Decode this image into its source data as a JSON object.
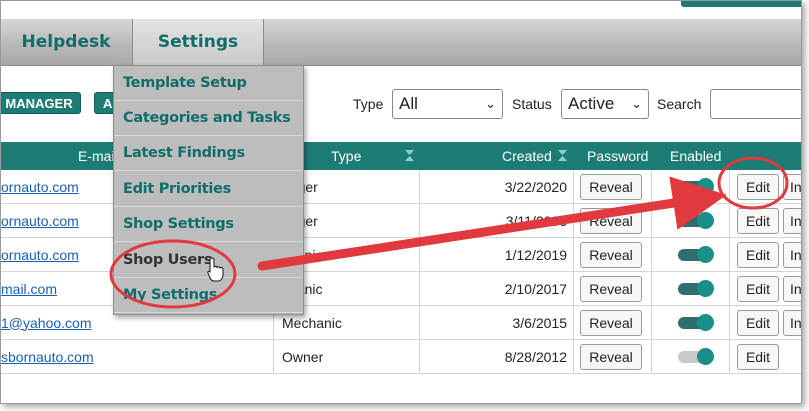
{
  "nav": {
    "helpdesk": "Helpdesk",
    "settings": "Settings"
  },
  "filters": {
    "role_buttons": [
      "MANAGER",
      "AI"
    ],
    "type_label": "Type",
    "type_value": "All",
    "status_label": "Status",
    "status_value": "Active",
    "search_label": "Search"
  },
  "table": {
    "headers": {
      "email": "E-mai",
      "type": "Type",
      "created": "Created",
      "password": "Password",
      "enabled": "Enabled"
    },
    "rows": [
      {
        "email": "ornauto.com",
        "type": "nager",
        "created": "3/22/2020",
        "reveal": "Reveal",
        "enabled": true,
        "edit": "Edit",
        "edit2": "In"
      },
      {
        "email": "ornauto.com",
        "type": "nager",
        "created": "3/11/2006",
        "reveal": "Reveal",
        "enabled": true,
        "edit": "Edit",
        "edit2": "In"
      },
      {
        "email": "ornauto.com",
        "type": "chanic",
        "created": "1/12/2019",
        "reveal": "Reveal",
        "enabled": true,
        "edit": "Edit",
        "edit2": "In"
      },
      {
        "email": "mail.com",
        "type": "chanic",
        "created": "2/10/2017",
        "reveal": "Reveal",
        "enabled": true,
        "edit": "Edit",
        "edit2": "In"
      },
      {
        "email": "1@yahoo.com",
        "type": "Mechanic",
        "created": "3/6/2015",
        "reveal": "Reveal",
        "enabled": true,
        "edit": "Edit",
        "edit2": "In"
      },
      {
        "email": "sbornauto.com",
        "type": "Owner",
        "created": "8/28/2012",
        "reveal": "Reveal",
        "enabled": false,
        "edit": "Edit",
        "edit2": ""
      }
    ]
  },
  "menu": {
    "items": [
      "Template Setup",
      "Categories and Tasks",
      "Latest Findings",
      "Edit Priorities",
      "Shop Settings",
      "Shop Users",
      "My Settings"
    ],
    "hovered": "Shop Users"
  },
  "colors": {
    "teal": "#1e7c76",
    "menu_text": "#0f6e6a",
    "annotation_red": "#e03a3e"
  },
  "icons": {
    "cursor": "hand-pointer-icon",
    "sort": "sort-arrows-icon"
  }
}
